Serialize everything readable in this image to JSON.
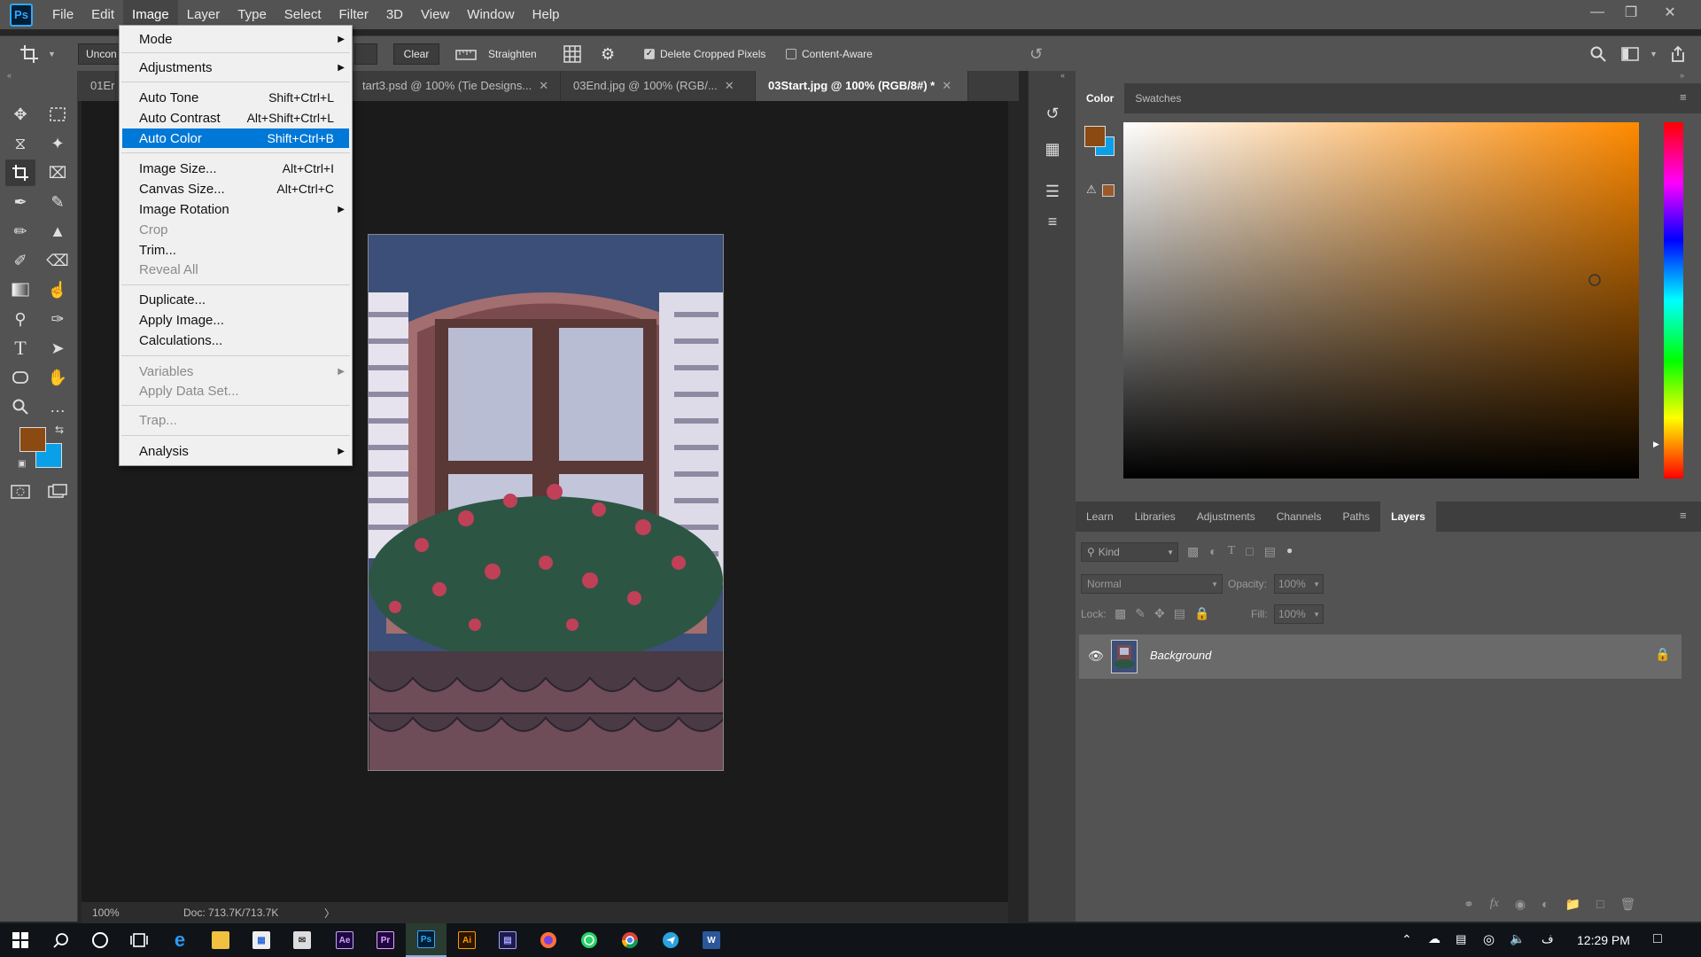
{
  "app": {
    "logo_text": "Ps"
  },
  "menubar": {
    "items": [
      "File",
      "Edit",
      "Image",
      "Layer",
      "Type",
      "Select",
      "Filter",
      "3D",
      "View",
      "Window",
      "Help"
    ],
    "active_index": 2
  },
  "options_bar": {
    "ratio_label": "Uncon",
    "clear_label": "Clear",
    "straighten_label": "Straighten",
    "delete_cropped_label": "Delete Cropped Pixels",
    "delete_cropped_checked": true,
    "content_aware_label": "Content-Aware",
    "content_aware_checked": false
  },
  "doc_tabs": [
    {
      "label": "01Er",
      "active": false
    },
    {
      "label": "tart3.psd @ 100% (Tie Designs...",
      "active": false
    },
    {
      "label": "03End.jpg @ 100% (RGB/...",
      "active": false
    },
    {
      "label": "03Start.jpg @ 100% (RGB/8#) *",
      "active": true
    }
  ],
  "image_menu": {
    "items": [
      {
        "label": "Mode",
        "shortcut": "",
        "submenu": true,
        "disabled": false
      },
      {
        "label": "Adjustments",
        "shortcut": "",
        "submenu": true,
        "disabled": false
      },
      {
        "label": "Auto Tone",
        "shortcut": "Shift+Ctrl+L",
        "submenu": false,
        "disabled": false
      },
      {
        "label": "Auto Contrast",
        "shortcut": "Alt+Shift+Ctrl+L",
        "submenu": false,
        "disabled": false
      },
      {
        "label": "Auto Color",
        "shortcut": "Shift+Ctrl+B",
        "submenu": false,
        "disabled": false,
        "highlighted": true
      },
      {
        "label": "Image Size...",
        "shortcut": "Alt+Ctrl+I",
        "submenu": false,
        "disabled": false
      },
      {
        "label": "Canvas Size...",
        "shortcut": "Alt+Ctrl+C",
        "submenu": false,
        "disabled": false
      },
      {
        "label": "Image Rotation",
        "shortcut": "",
        "submenu": true,
        "disabled": false
      },
      {
        "label": "Crop",
        "shortcut": "",
        "submenu": false,
        "disabled": true
      },
      {
        "label": "Trim...",
        "shortcut": "",
        "submenu": false,
        "disabled": false
      },
      {
        "label": "Reveal All",
        "shortcut": "",
        "submenu": false,
        "disabled": true
      },
      {
        "label": "Duplicate...",
        "shortcut": "",
        "submenu": false,
        "disabled": false
      },
      {
        "label": "Apply Image...",
        "shortcut": "",
        "submenu": false,
        "disabled": false
      },
      {
        "label": "Calculations...",
        "shortcut": "",
        "submenu": false,
        "disabled": false
      },
      {
        "label": "Variables",
        "shortcut": "",
        "submenu": true,
        "disabled": true
      },
      {
        "label": "Apply Data Set...",
        "shortcut": "",
        "submenu": false,
        "disabled": true
      },
      {
        "label": "Trap...",
        "shortcut": "",
        "submenu": false,
        "disabled": true
      },
      {
        "label": "Analysis",
        "shortcut": "",
        "submenu": true,
        "disabled": false
      }
    ]
  },
  "status_bar": {
    "zoom": "100%",
    "doc_info": "Doc: 713.7K/713.7K",
    "arrow": "〉"
  },
  "colors": {
    "foreground": "#8a4a12",
    "background": "#0aa0e8",
    "accent": "#0078d7"
  },
  "color_panel": {
    "tabs": [
      "Color",
      "Swatches"
    ],
    "active_tab": "Color"
  },
  "layers_panel": {
    "tabs": [
      "Learn",
      "Libraries",
      "Adjustments",
      "Channels",
      "Paths",
      "Layers"
    ],
    "active_tab": "Layers",
    "filter_placeholder": "Kind",
    "blend_mode": "Normal",
    "opacity_label": "Opacity:",
    "opacity_value": "100%",
    "lock_label": "Lock:",
    "fill_label": "Fill:",
    "fill_value": "100%",
    "layers": [
      {
        "name": "Background",
        "visible": true,
        "locked": true
      }
    ]
  },
  "taskbar": {
    "time": "12:29 PM"
  }
}
